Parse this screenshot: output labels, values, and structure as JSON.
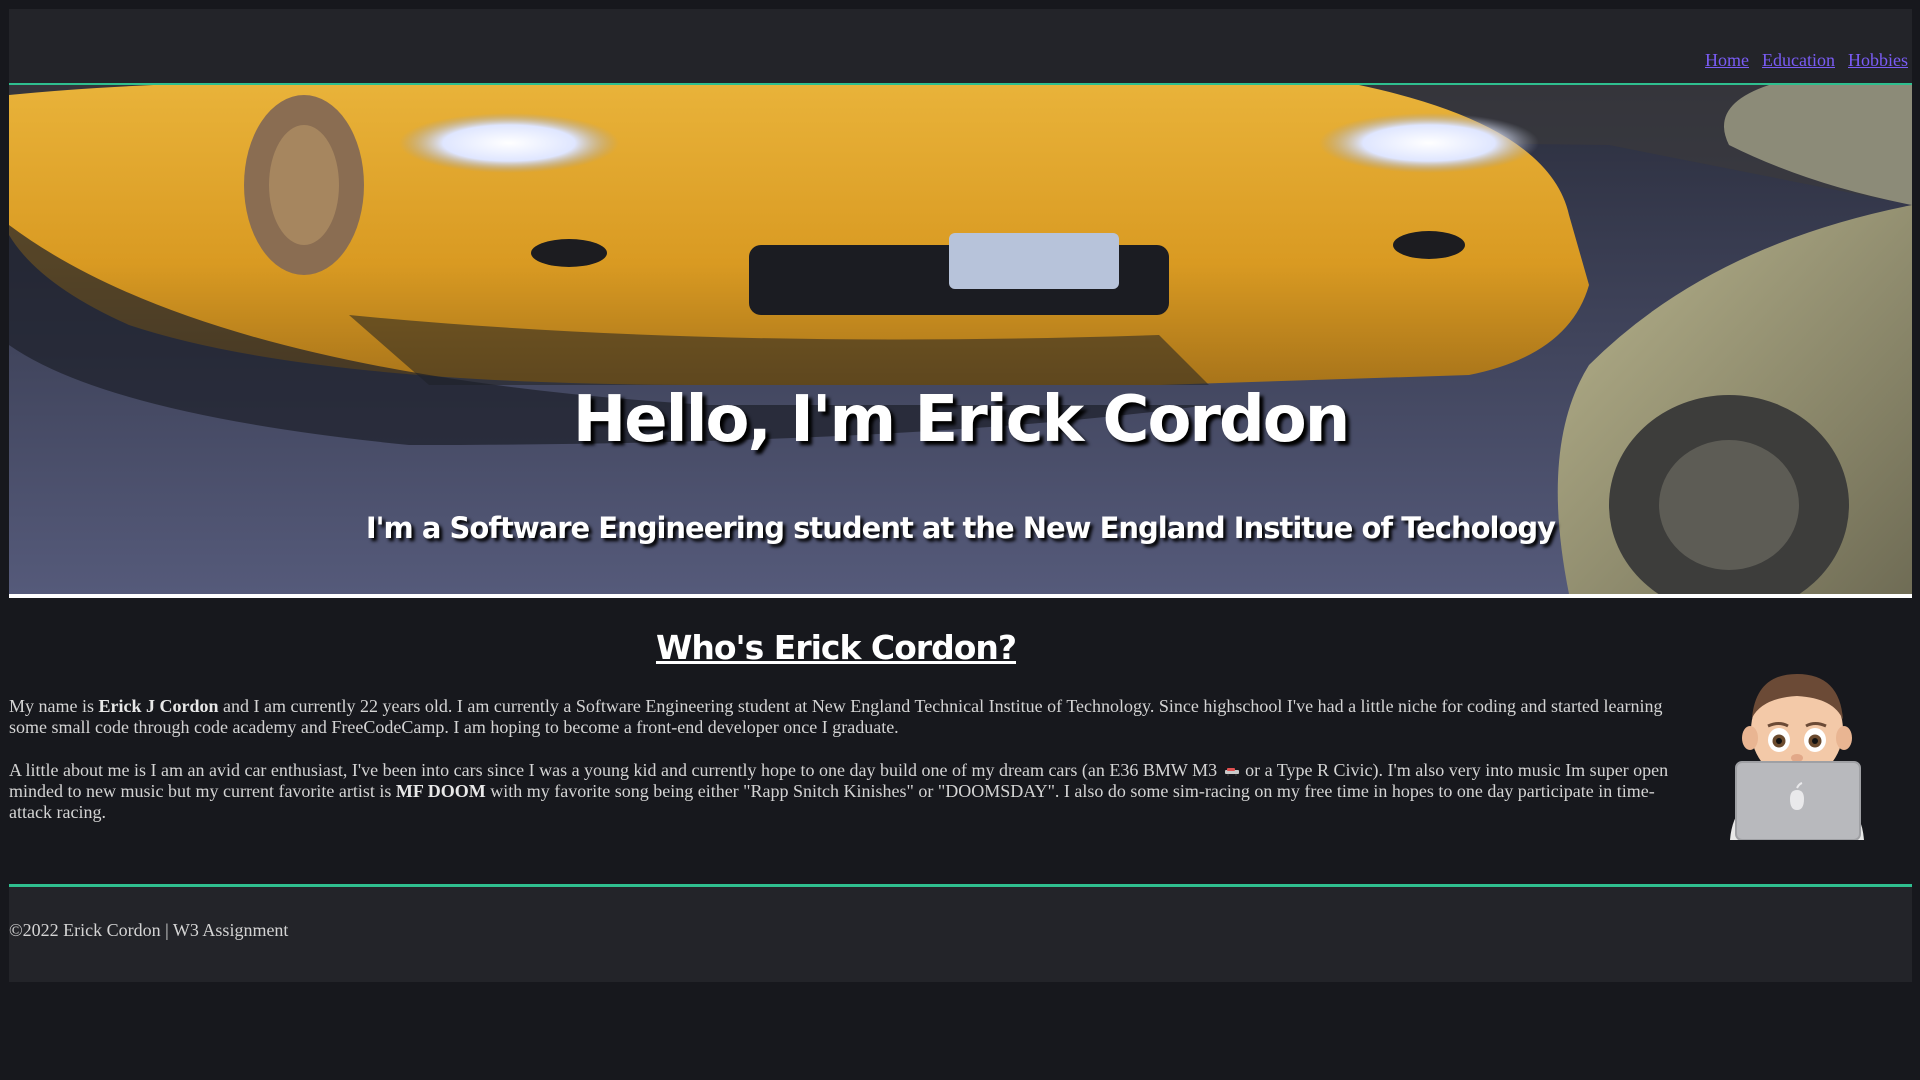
{
  "nav": {
    "items": [
      {
        "label": "Home"
      },
      {
        "label": "Education"
      },
      {
        "label": "Hobbies"
      }
    ]
  },
  "hero": {
    "title": "Hello, I'm Erick Cordon",
    "subtitle": "I'm a Software Engineering student at the New England Institue of Techology"
  },
  "about": {
    "heading": "Who's Erick Cordon?",
    "p1_before": "My name is ",
    "p1_name": "Erick J Cordon",
    "p1_after": " and I am currently 22 years old. I am currently a Software Engineering student at New England Technical Institue of Technology. Since highschool I've had a little niche for coding and started learning some small code through code academy and FreeCodeCamp. I am hoping to become a front-end developer once I graduate.",
    "p2_before": "A little about me is I am an avid car enthusiast, I've been into cars since I was a young kid and currently hope to one day build one of my dream cars (an E36 BMW M3",
    "p2_mid": "or a Type R Civic). I'm also very into music Im super open minded to new music but my current favorite artist is ",
    "p2_artist": "MF DOOM",
    "p2_after": " with my favorite song being either \"Rapp Snitch Kinishes\" or \"DOOMSDAY\". I also do some sim-racing on my free time in hopes to one day participate in time-attack racing."
  },
  "footer": {
    "text": "©2022 Erick Cordon | W3 Assignment"
  },
  "colors": {
    "background": "#17181d",
    "panel": "#232429",
    "accent": "#2fbf8f",
    "link": "#7a5cf5"
  }
}
